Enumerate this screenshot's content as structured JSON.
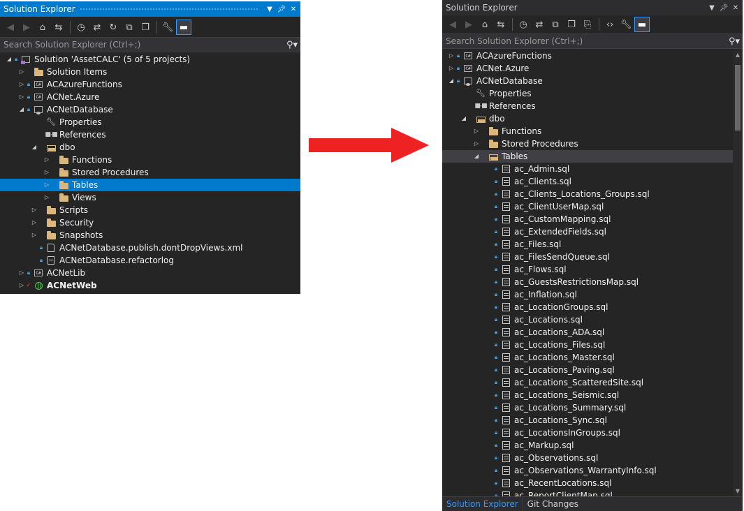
{
  "left_panel": {
    "title": "Solution Explorer",
    "search_placeholder": "Search Solution Explorer (Ctrl+;)",
    "tree": [
      {
        "label": "Solution 'AssetCALC' (5 of 5 projects)",
        "icon": "solution-icon",
        "expanded": true,
        "locked": true
      },
      {
        "label": "Solution Items",
        "icon": "folder-icon",
        "expanded": false
      },
      {
        "label": "ACAzureFunctions",
        "icon": "csharp-project-icon",
        "expanded": false,
        "locked": true
      },
      {
        "label": "ACNet.Azure",
        "icon": "csharp-project-icon",
        "expanded": false,
        "locked": true
      },
      {
        "label": "ACNetDatabase",
        "icon": "database-project-icon",
        "expanded": true,
        "locked": true
      },
      {
        "label": "Properties",
        "icon": "wrench-icon"
      },
      {
        "label": "References",
        "icon": "references-icon"
      },
      {
        "label": "dbo",
        "icon": "folder-open-icon",
        "expanded": true
      },
      {
        "label": "Functions",
        "icon": "folder-icon",
        "expanded": false
      },
      {
        "label": "Stored Procedures",
        "icon": "folder-icon",
        "expanded": false
      },
      {
        "label": "Tables",
        "icon": "folder-icon",
        "expanded": false,
        "selected": true
      },
      {
        "label": "Views",
        "icon": "folder-icon",
        "expanded": false
      },
      {
        "label": "Scripts",
        "icon": "folder-icon",
        "expanded": false
      },
      {
        "label": "Security",
        "icon": "folder-icon",
        "expanded": false
      },
      {
        "label": "Snapshots",
        "icon": "folder-icon",
        "expanded": false
      },
      {
        "label": "ACNetDatabase.publish.dontDropViews.xml",
        "icon": "xml-file-icon",
        "locked": true
      },
      {
        "label": "ACNetDatabase.refactorlog",
        "icon": "file-icon",
        "locked": true
      },
      {
        "label": "ACNetLib",
        "icon": "csharp-project-icon",
        "expanded": false,
        "locked": true
      },
      {
        "label": "ACNetWeb",
        "icon": "web-project-icon",
        "expanded": false,
        "checked": true,
        "bold": true
      }
    ]
  },
  "right_panel": {
    "title": "Solution Explorer",
    "search_placeholder": "Search Solution Explorer (Ctrl+;)",
    "tree": [
      {
        "label": "ACAzureFunctions",
        "icon": "csharp-project-icon",
        "expanded": false,
        "locked": true
      },
      {
        "label": "ACNet.Azure",
        "icon": "csharp-project-icon",
        "expanded": false,
        "locked": true
      },
      {
        "label": "ACNetDatabase",
        "icon": "database-project-icon",
        "expanded": true,
        "locked": true
      },
      {
        "label": "Properties",
        "icon": "wrench-icon"
      },
      {
        "label": "References",
        "icon": "references-icon"
      },
      {
        "label": "dbo",
        "icon": "folder-open-icon",
        "expanded": true
      },
      {
        "label": "Functions",
        "icon": "folder-icon",
        "expanded": false
      },
      {
        "label": "Stored Procedures",
        "icon": "folder-icon",
        "expanded": false
      },
      {
        "label": "Tables",
        "icon": "folder-open-icon",
        "expanded": true,
        "hover": true
      },
      {
        "label": "ac_Admin.sql",
        "icon": "sql-table-icon",
        "locked": true
      },
      {
        "label": "ac_Clients.sql",
        "icon": "sql-table-icon",
        "locked": true
      },
      {
        "label": "ac_Clients_Locations_Groups.sql",
        "icon": "sql-table-icon",
        "locked": true
      },
      {
        "label": "ac_ClientUserMap.sql",
        "icon": "sql-table-icon",
        "locked": true
      },
      {
        "label": "ac_CustomMapping.sql",
        "icon": "sql-table-icon",
        "locked": true
      },
      {
        "label": "ac_ExtendedFields.sql",
        "icon": "sql-table-icon",
        "locked": true
      },
      {
        "label": "ac_Files.sql",
        "icon": "sql-table-icon",
        "locked": true
      },
      {
        "label": "ac_FilesSendQueue.sql",
        "icon": "sql-table-icon",
        "locked": true
      },
      {
        "label": "ac_Flows.sql",
        "icon": "sql-table-icon",
        "locked": true
      },
      {
        "label": "ac_GuestsRestrictionsMap.sql",
        "icon": "sql-table-icon",
        "locked": true
      },
      {
        "label": "ac_Inflation.sql",
        "icon": "sql-table-icon",
        "locked": true
      },
      {
        "label": "ac_LocationGroups.sql",
        "icon": "sql-table-icon",
        "locked": true
      },
      {
        "label": "ac_Locations.sql",
        "icon": "sql-table-icon",
        "locked": true
      },
      {
        "label": "ac_Locations_ADA.sql",
        "icon": "sql-table-icon",
        "locked": true
      },
      {
        "label": "ac_Locations_Files.sql",
        "icon": "sql-table-icon",
        "locked": true
      },
      {
        "label": "ac_Locations_Master.sql",
        "icon": "sql-table-icon",
        "locked": true
      },
      {
        "label": "ac_Locations_Paving.sql",
        "icon": "sql-table-icon",
        "locked": true
      },
      {
        "label": "ac_Locations_ScatteredSite.sql",
        "icon": "sql-table-icon",
        "locked": true
      },
      {
        "label": "ac_Locations_Seismic.sql",
        "icon": "sql-table-icon",
        "locked": true
      },
      {
        "label": "ac_Locations_Summary.sql",
        "icon": "sql-table-icon",
        "locked": true
      },
      {
        "label": "ac_Locations_Sync.sql",
        "icon": "sql-table-icon",
        "locked": true
      },
      {
        "label": "ac_LocationsInGroups.sql",
        "icon": "sql-table-icon",
        "locked": true
      },
      {
        "label": "ac_Markup.sql",
        "icon": "sql-table-icon",
        "locked": true
      },
      {
        "label": "ac_Observations.sql",
        "icon": "sql-table-icon",
        "locked": true
      },
      {
        "label": "ac_Observations_WarrantyInfo.sql",
        "icon": "sql-table-icon",
        "locked": true
      },
      {
        "label": "ac_RecentLocations.sql",
        "icon": "sql-table-icon",
        "locked": true
      },
      {
        "label": "ac_ReportClientMap.sql",
        "icon": "sql-table-icon",
        "locked": true
      }
    ],
    "bottom_tabs": [
      "Solution Explorer",
      "Git Changes"
    ]
  },
  "colors": {
    "panel_bg": "#252526",
    "active_title_bg": "#007acc",
    "selection": "#007acc",
    "hover": "#3f3f46",
    "arrow": "#ee2222",
    "folder": "#dcb67a"
  }
}
